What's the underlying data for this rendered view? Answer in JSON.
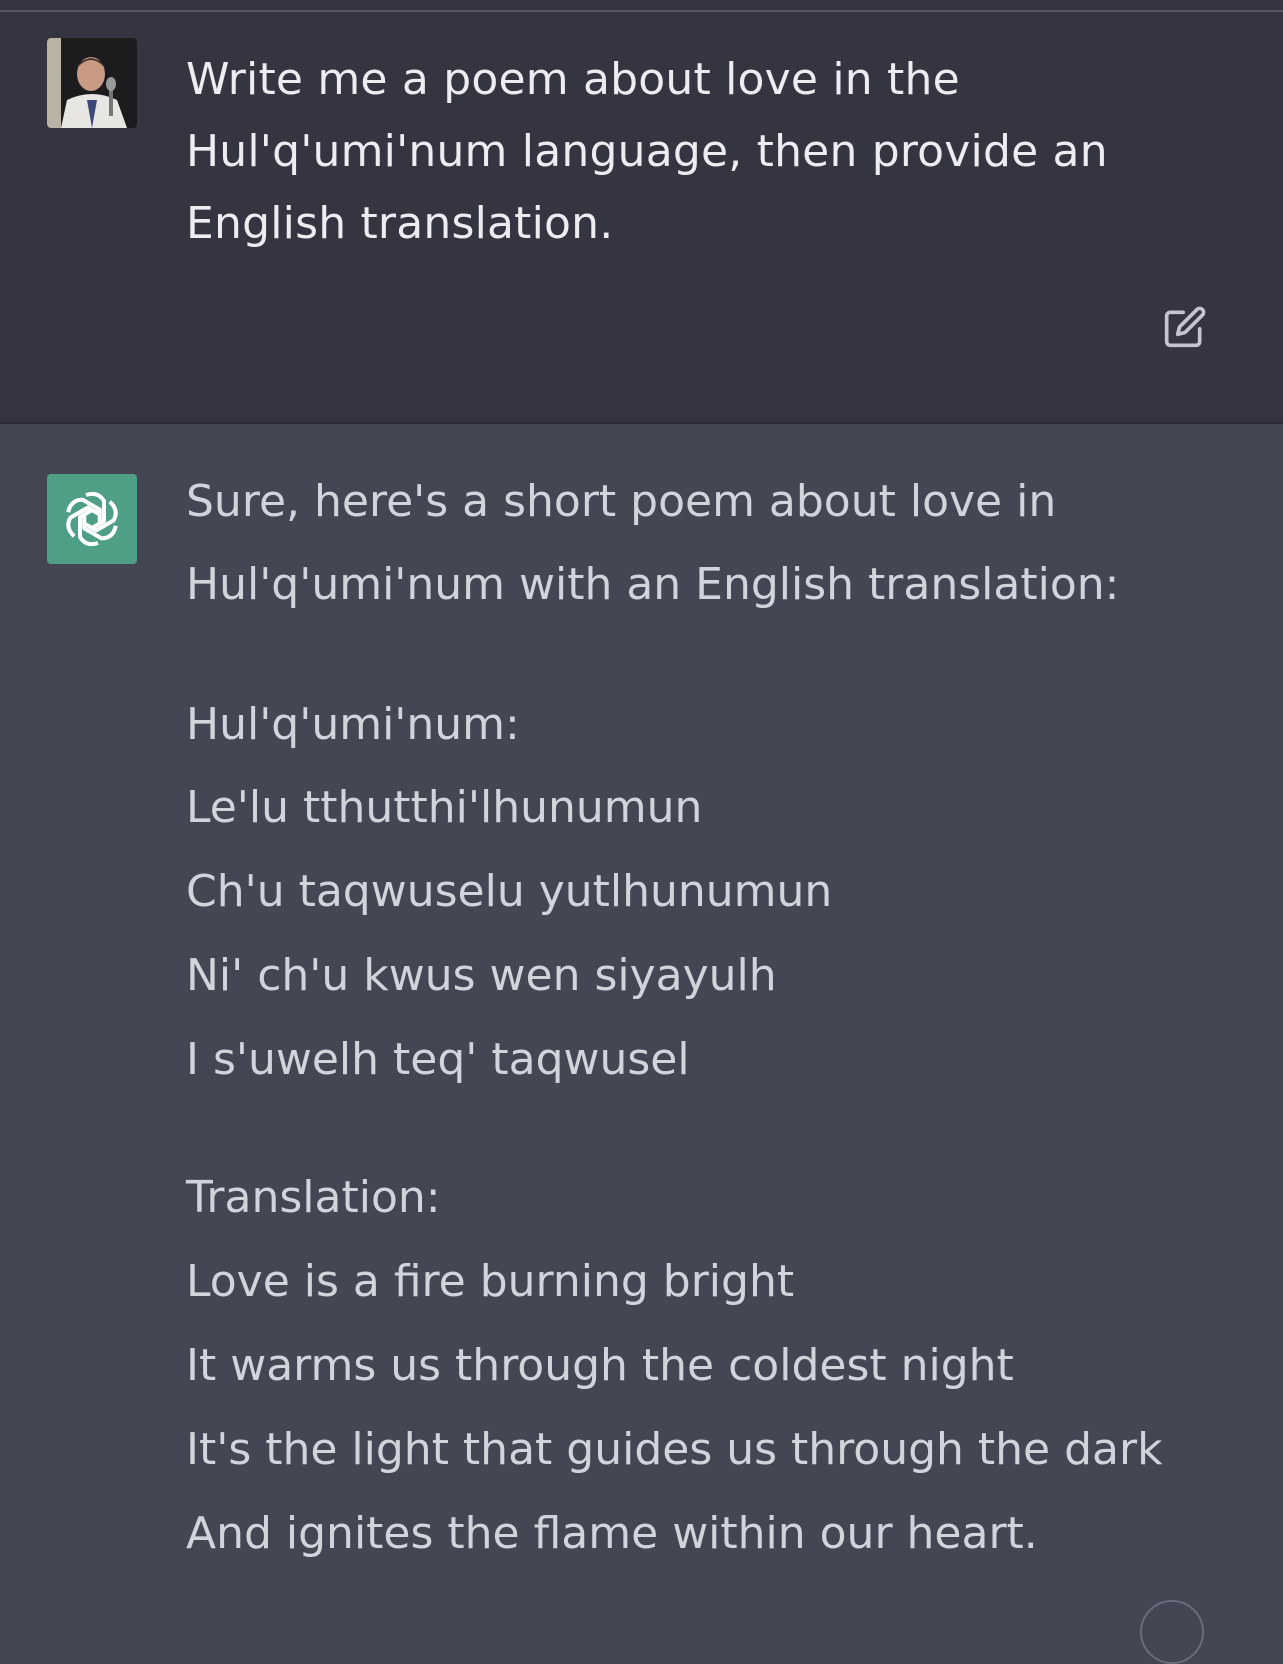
{
  "user_message": {
    "lines": [
      "Write me a poem about love in the",
      "Hul'q'umi'num language, then provide an",
      "English translation."
    ]
  },
  "assistant_message": {
    "intro": [
      "Sure, here's a short poem about love in",
      "Hul'q'umi'num with an English translation:"
    ],
    "poem_heading": "Hul'q'umi'num:",
    "poem_lines": [
      "Le'lu tthutthi'lhunumun",
      "Ch'u taqwuselu yutlhunumun",
      "Ni' ch'u kwus wen siyayulh",
      "I s'uwelh teq' taqwusel"
    ],
    "translation_heading": "Translation:",
    "translation_lines": [
      "Love is a fire burning bright",
      "It warms us through the coldest night",
      "It's the light that guides us through the dark",
      "And ignites the flame within our heart."
    ]
  },
  "icons": {
    "edit": "edit-icon",
    "assistant_logo": "openai-logo-icon",
    "user_avatar": "user-avatar"
  },
  "colors": {
    "user_bg": "#343541",
    "assistant_bg": "#444654",
    "logo_bg": "#4f9f86",
    "text": "#ececf1"
  }
}
